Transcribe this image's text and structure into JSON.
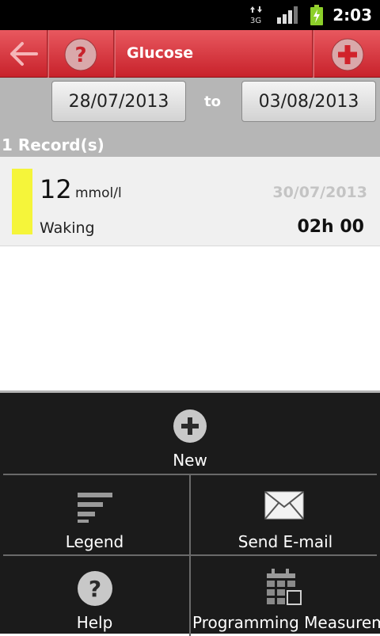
{
  "status_bar": {
    "time": "2:03",
    "network": "3G"
  },
  "toolbar": {
    "title": "Glucose",
    "back_icon": "back-arrow-icon",
    "help_icon": "question-icon",
    "add_icon": "plus-icon"
  },
  "date_range": {
    "from": "28/07/2013",
    "to_label": "to",
    "to": "03/08/2013"
  },
  "records_header": "1 Record(s)",
  "records": [
    {
      "value": "12",
      "unit": "mmol/l",
      "date": "30/07/2013",
      "label": "Waking",
      "time": "02h 00",
      "color": "#f5f53a"
    }
  ],
  "menu": {
    "new": "New",
    "legend": "Legend",
    "send_email": "Send E-mail",
    "help": "Help",
    "programming": "Programming Measurements"
  },
  "colors": {
    "accent": "#d63a41",
    "menu_bg": "#1b1b1b"
  }
}
